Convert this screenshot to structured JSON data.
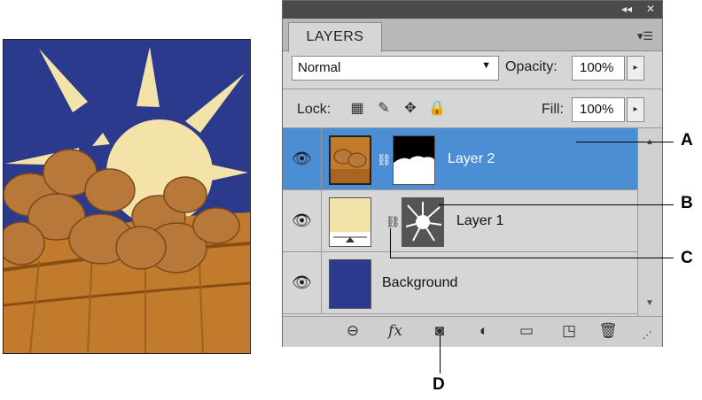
{
  "panel": {
    "tab_label": "LAYERS",
    "strip_buttons": [
      "◂◂",
      "✕"
    ],
    "menu_icon": "panel-menu-icon",
    "blend_mode": "Normal",
    "opacity_label": "Opacity:",
    "opacity_value": "100%",
    "lock_label": "Lock:",
    "fill_label": "Fill:",
    "fill_value": "100%"
  },
  "layers": [
    {
      "name": "Layer 2",
      "selected": true
    },
    {
      "name": "Layer 1",
      "selected": false
    },
    {
      "name": "Background",
      "selected": false
    }
  ],
  "bottom_icons": [
    "link-layers-icon",
    "fx-icon",
    "add-mask-icon",
    "adjustment-layer-icon",
    "new-group-icon",
    "new-layer-icon",
    "trash-icon"
  ],
  "bottom_fx": "fx",
  "callouts": [
    "A",
    "B",
    "C",
    "D"
  ],
  "colors": {
    "selected_row": "#4b8ed4",
    "panel_bg": "#d6d6d6",
    "illustration_blue": "#2b3a8c",
    "sun_cream": "#f3e3a8"
  }
}
